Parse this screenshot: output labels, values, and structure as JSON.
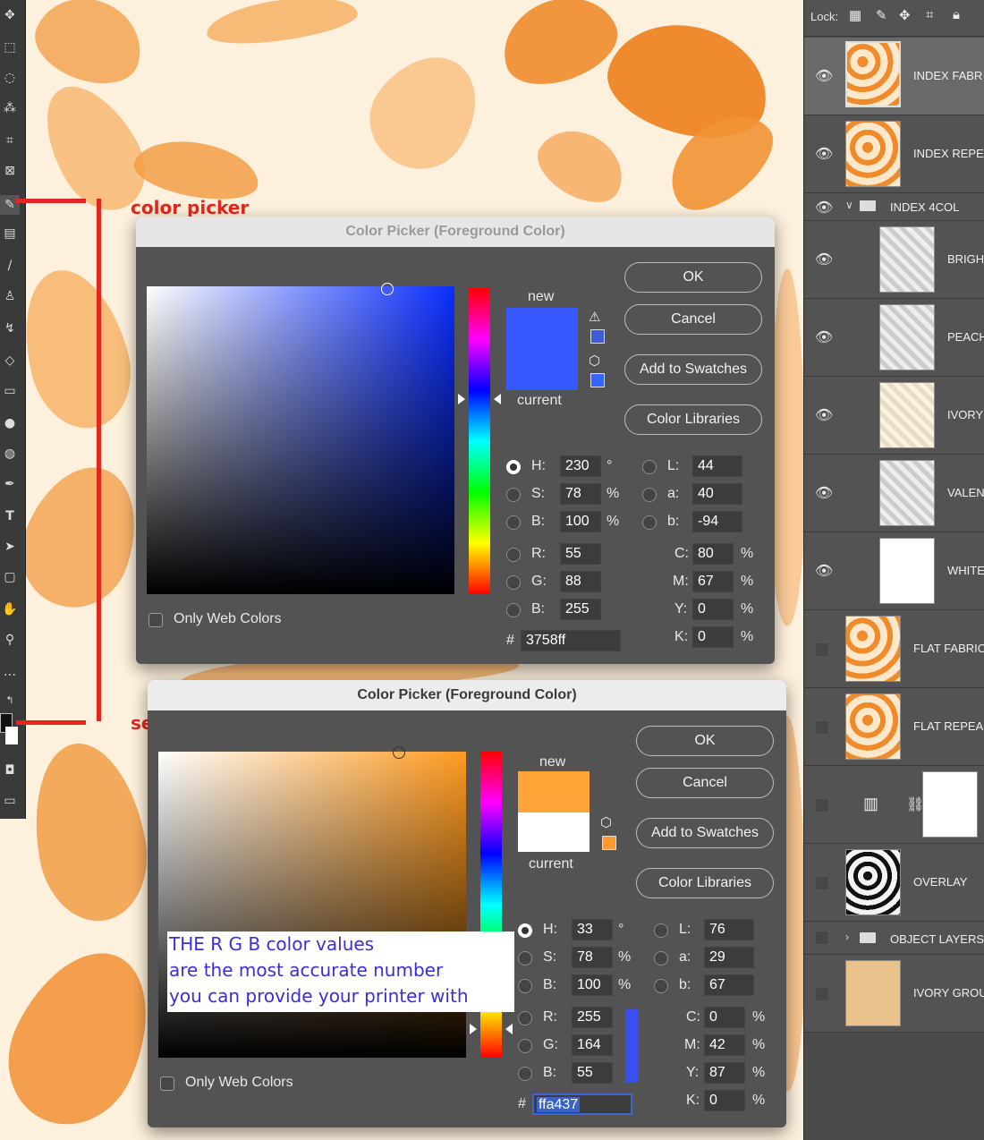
{
  "annotations": {
    "color_picker": "color picker",
    "select_color": "select color",
    "rgb_note": [
      "THE R G B color values",
      "are the most accurate number",
      "you can provide your printer with"
    ]
  },
  "dialog_top": {
    "title": "Color Picker (Foreground Color)",
    "new_label": "new",
    "current_label": "current",
    "new_color": "#3758ff",
    "current_color": "#3758ff",
    "buttons": {
      "ok": "OK",
      "cancel": "Cancel",
      "swatches": "Add to Swatches",
      "libraries": "Color Libraries"
    },
    "only_web": "Only Web Colors",
    "fields": {
      "H": "230",
      "S": "78",
      "B": "100",
      "R": "55",
      "G": "88",
      "Bl": "255",
      "L": "44",
      "a": "40",
      "b": "-94",
      "C": "80",
      "M": "67",
      "Y": "0",
      "K": "0",
      "hex": "3758ff"
    },
    "units": {
      "deg": "°",
      "pct": "%",
      "hash": "#"
    }
  },
  "dialog_bottom": {
    "title": "Color Picker (Foreground Color)",
    "new_label": "new",
    "current_label": "current",
    "new_color": "#ffa437",
    "current_color": "#ffffff",
    "buttons": {
      "ok": "OK",
      "cancel": "Cancel",
      "swatches": "Add to Swatches",
      "libraries": "Color Libraries"
    },
    "only_web": "Only Web Colors",
    "fields": {
      "H": "33",
      "S": "78",
      "B": "100",
      "R": "255",
      "G": "164",
      "Bl": "55",
      "L": "76",
      "a": "29",
      "b": "67",
      "C": "0",
      "M": "42",
      "Y": "87",
      "K": "0",
      "hex": "ffa437"
    }
  },
  "labels": {
    "H": "H:",
    "S": "S:",
    "B": "B:",
    "R": "R:",
    "G": "G:",
    "Bl": "B:",
    "L": "L:",
    "a": "a:",
    "b": "b:",
    "C": "C:",
    "M": "M:",
    "Y": "Y:",
    "K": "K:"
  },
  "layers": {
    "lock_label": "Lock:",
    "items": [
      {
        "name": "INDEX FABR"
      },
      {
        "name": "INDEX REPE"
      },
      {
        "name": "INDEX 4COL"
      },
      {
        "name": "BRIGH"
      },
      {
        "name": "PEACH"
      },
      {
        "name": "IVORY"
      },
      {
        "name": "VALEN"
      },
      {
        "name": "WHITE"
      },
      {
        "name": "FLAT FABRIC"
      },
      {
        "name": "FLAT REPEA"
      },
      {
        "name": ""
      },
      {
        "name": "OVERLAY"
      },
      {
        "name": "OBJECT LAYERS"
      },
      {
        "name": "IVORY GROU"
      }
    ]
  },
  "colors": {
    "accent_red": "#e5261c",
    "note_blue": "#3a2fd6"
  }
}
